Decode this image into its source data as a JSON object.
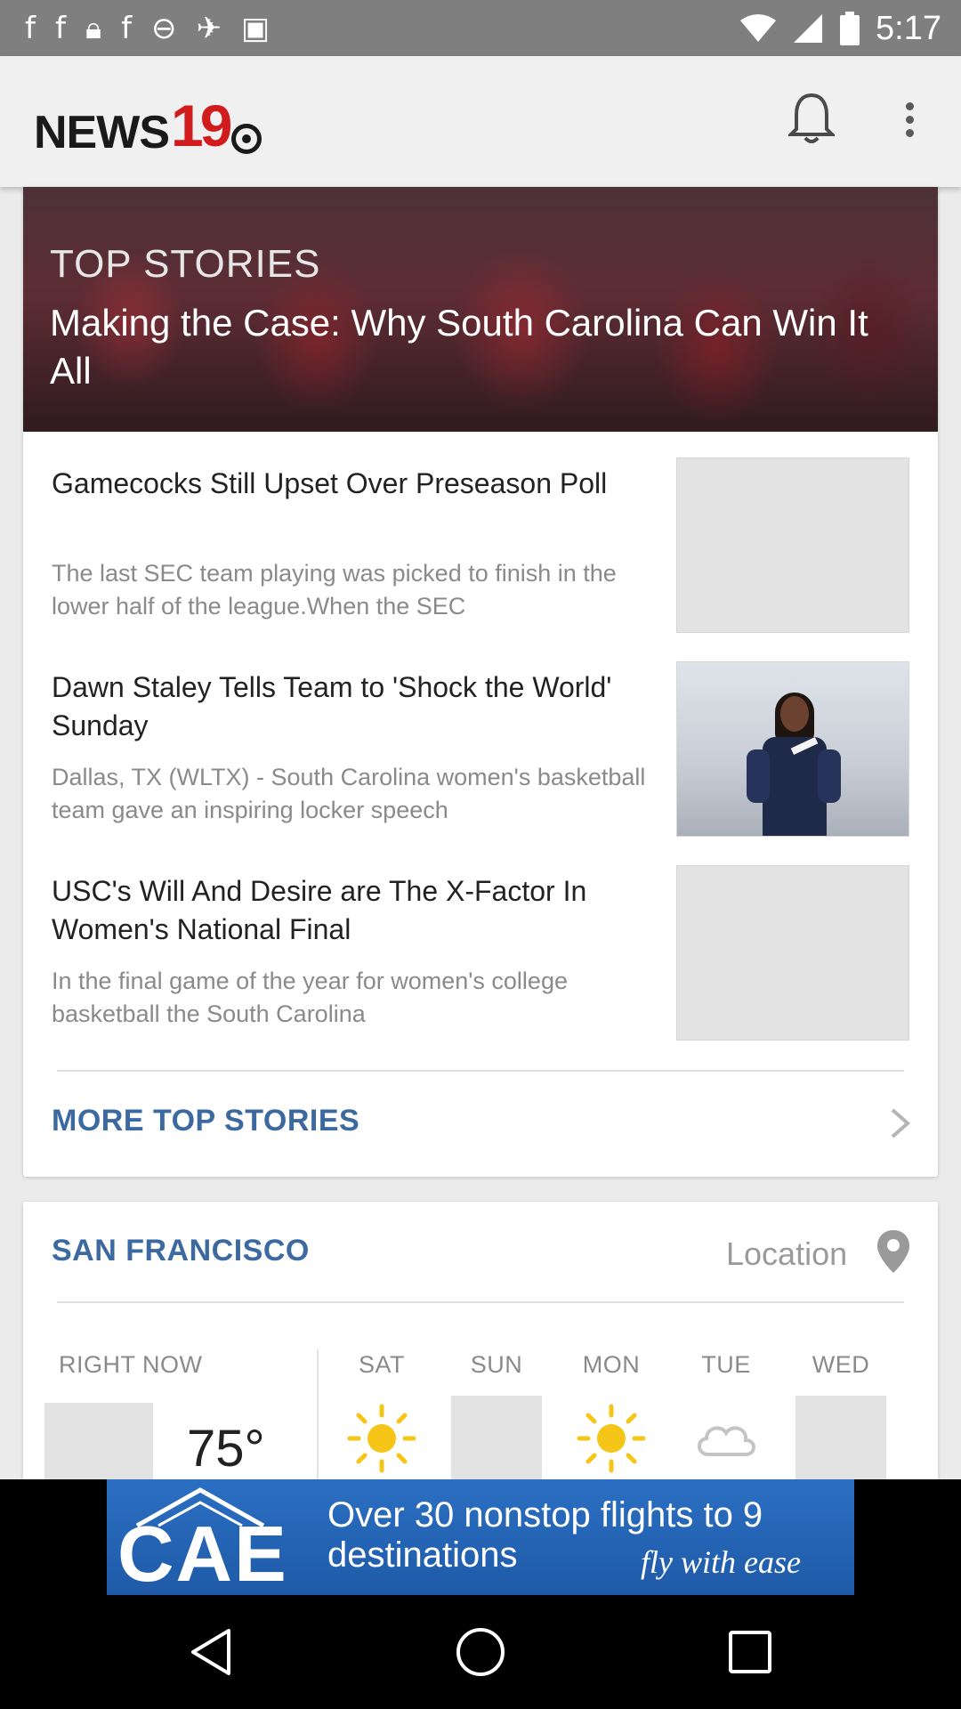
{
  "status_bar": {
    "time": "5:17",
    "icons": [
      "facebook-icon",
      "facebook-icon",
      "lock-icon",
      "facebook-icon",
      "do-not-disturb-icon",
      "satellite-icon",
      "android-icon"
    ]
  },
  "app_bar": {
    "logo_text": "NEWS",
    "logo_number": "19",
    "icons": [
      "bell-icon",
      "more-vert-icon"
    ],
    "brand_color": "#d01c1c"
  },
  "top_stories": {
    "hero": {
      "kicker": "TOP STORIES",
      "title": "Making the Case: Why South Carolina Can Win It All"
    },
    "items": [
      {
        "title": "Gamecocks Still Upset Over Preseason Poll",
        "description": "The last SEC team playing was picked to finish in the lower half of the league.When the SEC"
      },
      {
        "title": "Dawn Staley Tells Team to 'Shock the World' Sunday",
        "description": "Dallas, TX (WLTX) - South Carolina women's basketball team gave an inspiring locker speech"
      },
      {
        "title": "USC's Will And Desire are The X-Factor In Women's National Final",
        "description": "In the final game of the year for women's college basketball the South Carolina"
      }
    ],
    "more_label": "MORE TOP STORIES",
    "link_color": "#3c6aa0"
  },
  "weather": {
    "city": "SAN FRANCISCO",
    "location_label": "Location",
    "now_label": "RIGHT NOW",
    "now_temp": "75°",
    "days": [
      {
        "label": "SAT",
        "icon": "sun-icon"
      },
      {
        "label": "SUN",
        "icon": "placeholder"
      },
      {
        "label": "MON",
        "icon": "sun-icon"
      },
      {
        "label": "TUE",
        "icon": "cloud-icon"
      },
      {
        "label": "WED",
        "icon": "placeholder"
      }
    ]
  },
  "ad": {
    "brand": "CAE",
    "line1": "Over 30 nonstop flights to 9 destinations",
    "line2": "fly with ease"
  },
  "nav": {
    "buttons": [
      "back-icon",
      "home-icon",
      "recents-icon"
    ]
  }
}
